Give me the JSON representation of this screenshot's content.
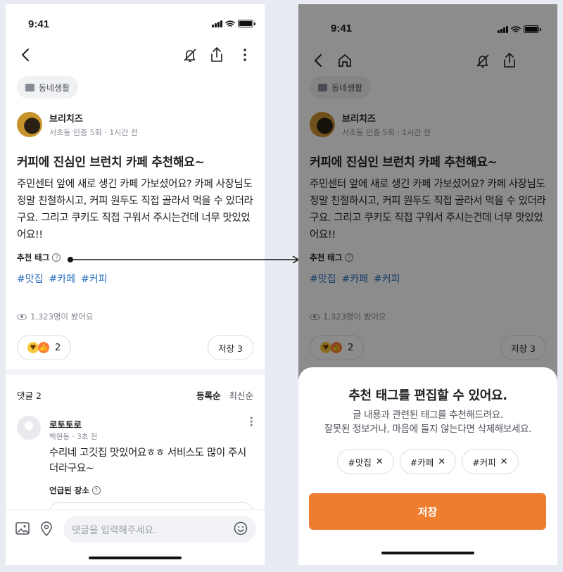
{
  "status": {
    "time": "9:41"
  },
  "post": {
    "category": "동네생활",
    "author": "브리치즈",
    "author_meta": "서초동 인증 5회 · 1시간 전",
    "title": "커피에 진심인 브런치 카페 추천해요~",
    "body": "주민센터 앞에 새로 생긴 카페 가보셨어요? 카페 사장님도 정말 친절하시고, 커피 원두도 직접 골라서 먹을 수 있더라구요. 그리고 쿠키도 직접 구워서 주시는건데 너무 맛있었어요!!",
    "tag_label": "추천 태그",
    "tags": [
      "#맛집",
      "#카페",
      "#커피"
    ],
    "views": "1,323명이 봤어요",
    "reactions_count": "2",
    "save_label": "저장 3"
  },
  "comments": {
    "header": "댓글 2",
    "sort_options": [
      "등록순",
      "최신순"
    ],
    "items": [
      {
        "name": "로토토로",
        "meta": "백현동 · 3초 전",
        "text": "수리네 고깃집 맛있어요ㅎㅎ 서비스도 많이 주시더라구요~",
        "place_label": "언급된 장소"
      }
    ]
  },
  "input": {
    "placeholder": "댓글을 입력해주세요."
  },
  "sheet": {
    "title": "추천 태그를 편집할 수 있어요.",
    "desc_line1": "글 내용과 관련된 태그를 추천해드려요.",
    "desc_line2": "잘못된 정보거나, 마음에 들지 않는다면 삭제해보세요.",
    "chips": [
      "#맛집",
      "#카페",
      "#커피"
    ],
    "save": "저장"
  },
  "colors": {
    "accent": "#ee7d2f",
    "hashtag": "#2a6fc0",
    "background": "#e8ebf2"
  }
}
